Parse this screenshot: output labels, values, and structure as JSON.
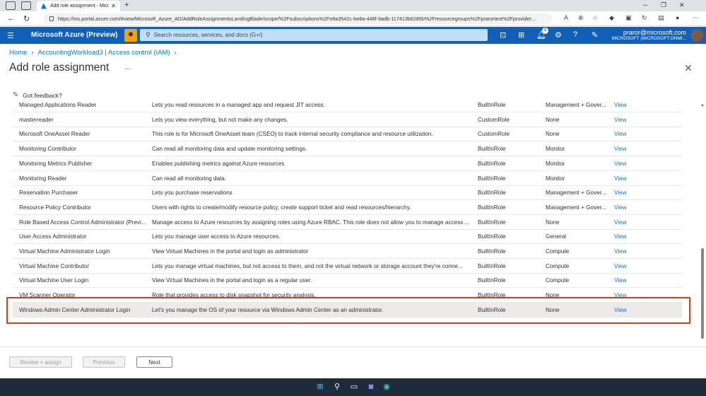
{
  "browser": {
    "tab_title": "Add role assignment - Microsoft",
    "url": "https://ms.portal.azure.com/#view/Microsoft_Azure_AD/AddRoleAssignmentsLandingBlade/scope/%2Fsubscriptions%2Fe8a3542c-be8a-448f-9adb-117413b6285b%2Fresourcegroups%2Fprarortest%2Fprovider..."
  },
  "azure": {
    "brand": "Microsoft Azure (Preview)",
    "search_placeholder": "Search resources, services, and docs (G+/)",
    "notification_count": "1",
    "user_email": "praror@microsoft.com",
    "user_tenant": "MICROSOFT (MICROSOFT.ONMI..."
  },
  "breadcrumb": [
    "Home",
    "AccountingWorkload3 | Access control (IAM)"
  ],
  "page_title": "Add role assignment",
  "more_label": "...",
  "feedback_label": "Got feedback?",
  "roles": [
    {
      "name": "Managed Applications Reader",
      "description": "Lets you read resources in a managed app and request JIT access.",
      "type": "BuiltInRole",
      "category": "Management + Gover...",
      "action": "View"
    },
    {
      "name": "masterreader",
      "description": "Lets you view everything, but not make any changes.",
      "type": "CustomRole",
      "category": "None",
      "action": "View"
    },
    {
      "name": "Microsoft OneAsset Reader",
      "description": "This role is for Microsoft OneAsset team (CSEO) to track internal security compliance and resource utilization.",
      "type": "CustomRole",
      "category": "None",
      "action": "View"
    },
    {
      "name": "Monitoring Contributor",
      "description": "Can read all monitoring data and update monitoring settings.",
      "type": "BuiltInRole",
      "category": "Monitor",
      "action": "View"
    },
    {
      "name": "Monitoring Metrics Publisher",
      "description": "Enables publishing metrics against Azure resources",
      "type": "BuiltInRole",
      "category": "Monitor",
      "action": "View"
    },
    {
      "name": "Monitoring Reader",
      "description": "Can read all monitoring data.",
      "type": "BuiltInRole",
      "category": "Monitor",
      "action": "View"
    },
    {
      "name": "Reservation Purchaser",
      "description": "Lets you purchase reservations",
      "type": "BuiltInRole",
      "category": "Management + Gover...",
      "action": "View"
    },
    {
      "name": "Resource Policy Contributor",
      "description": "Users with rights to create/modify resource policy, create support ticket and read resources/hierarchy.",
      "type": "BuiltInRole",
      "category": "Management + Gover...",
      "action": "View"
    },
    {
      "name": "Role Based Access Control Administrator (Previ...",
      "description": "Manage access to Azure resources by assigning roles using Azure RBAC. This role does not allow you to manage access ...",
      "type": "BuiltInRole",
      "category": "None",
      "action": "View"
    },
    {
      "name": "User Access Administrator",
      "description": "Lets you manage user access to Azure resources.",
      "type": "BuiltInRole",
      "category": "General",
      "action": "View"
    },
    {
      "name": "Virtual Machine Administrator Login",
      "description": "View Virtual Machines in the portal and login as administrator",
      "type": "BuiltInRole",
      "category": "Compute",
      "action": "View"
    },
    {
      "name": "Virtual Machine Contributor",
      "description": "Lets you manage virtual machines, but not access to them, and not the virtual network or storage account they're conne...",
      "type": "BuiltInRole",
      "category": "Compute",
      "action": "View"
    },
    {
      "name": "Virtual Machine User Login",
      "description": "View Virtual Machines in the portal and login as a regular user.",
      "type": "BuiltInRole",
      "category": "Compute",
      "action": "View"
    },
    {
      "name": "VM Scanner Operator",
      "description": "Role that provides access to disk snapshot for security analysis.",
      "type": "BuiltInRole",
      "category": "None",
      "action": "View"
    },
    {
      "name": "Windows Admin Center Administrator Login",
      "description": "Let's you manage the OS of your resource via Windows Admin Center as an administrator.",
      "type": "BuiltInRole",
      "category": "None",
      "action": "View"
    }
  ],
  "footer": {
    "review_assign": "Review + assign",
    "previous": "Previous",
    "next": "Next"
  },
  "colors": {
    "azure_header": "#1160b7",
    "link": "#0078d4",
    "highlight": "#d1401a"
  }
}
